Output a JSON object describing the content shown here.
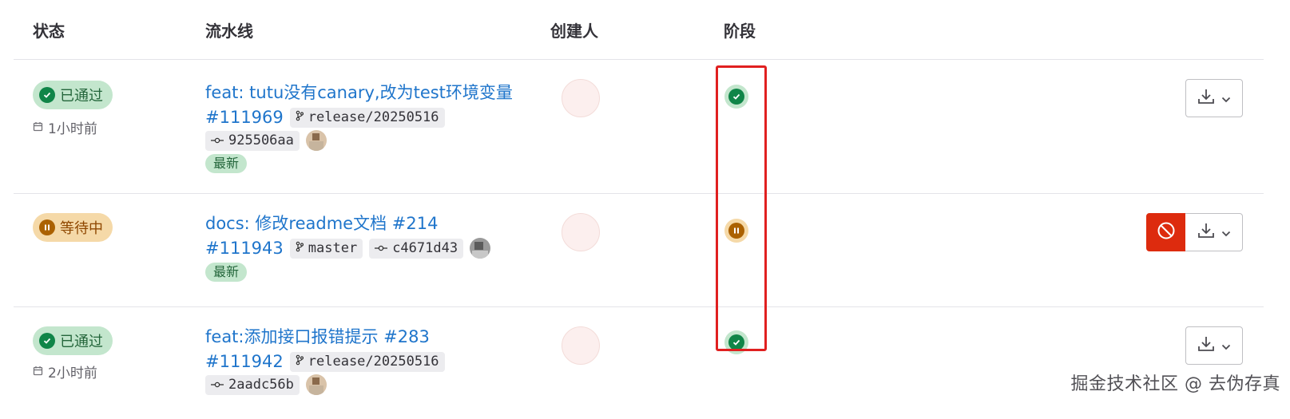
{
  "headers": {
    "status": "状态",
    "pipeline": "流水线",
    "creator": "创建人",
    "stages": "阶段"
  },
  "rows": [
    {
      "status_label": "已通过",
      "status": "passed",
      "time": "1小时前",
      "title": "feat: tutu没有canary,改为test环境变量",
      "id": "#111969",
      "branch": "release/20250516",
      "commit": "925506aa",
      "tag": "最新",
      "stage_status": "passed"
    },
    {
      "status_label": "等待中",
      "status": "waiting",
      "title": "docs: 修改readme文档 #214",
      "id": "#111943",
      "branch": "master",
      "commit": "c4671d43",
      "tag": "最新",
      "stage_status": "waiting"
    },
    {
      "status_label": "已通过",
      "status": "passed",
      "time": "2小时前",
      "title": "feat:添加接口报错提示 #283",
      "id": "#111942",
      "branch": "release/20250516",
      "commit": "2aadc56b",
      "stage_status": "passed"
    }
  ],
  "watermark": "掘金技术社区 @ 去伪存真",
  "colors": {
    "link": "#1f75cb",
    "success": "#108548",
    "warning": "#ab6100",
    "danger": "#dd2b0e",
    "highlight": "#e02020"
  },
  "icons": [
    "check-circle-icon",
    "pause-icon",
    "calendar-icon",
    "branch-icon",
    "commit-icon",
    "download-icon",
    "chevron-down-icon",
    "cancel-icon"
  ]
}
